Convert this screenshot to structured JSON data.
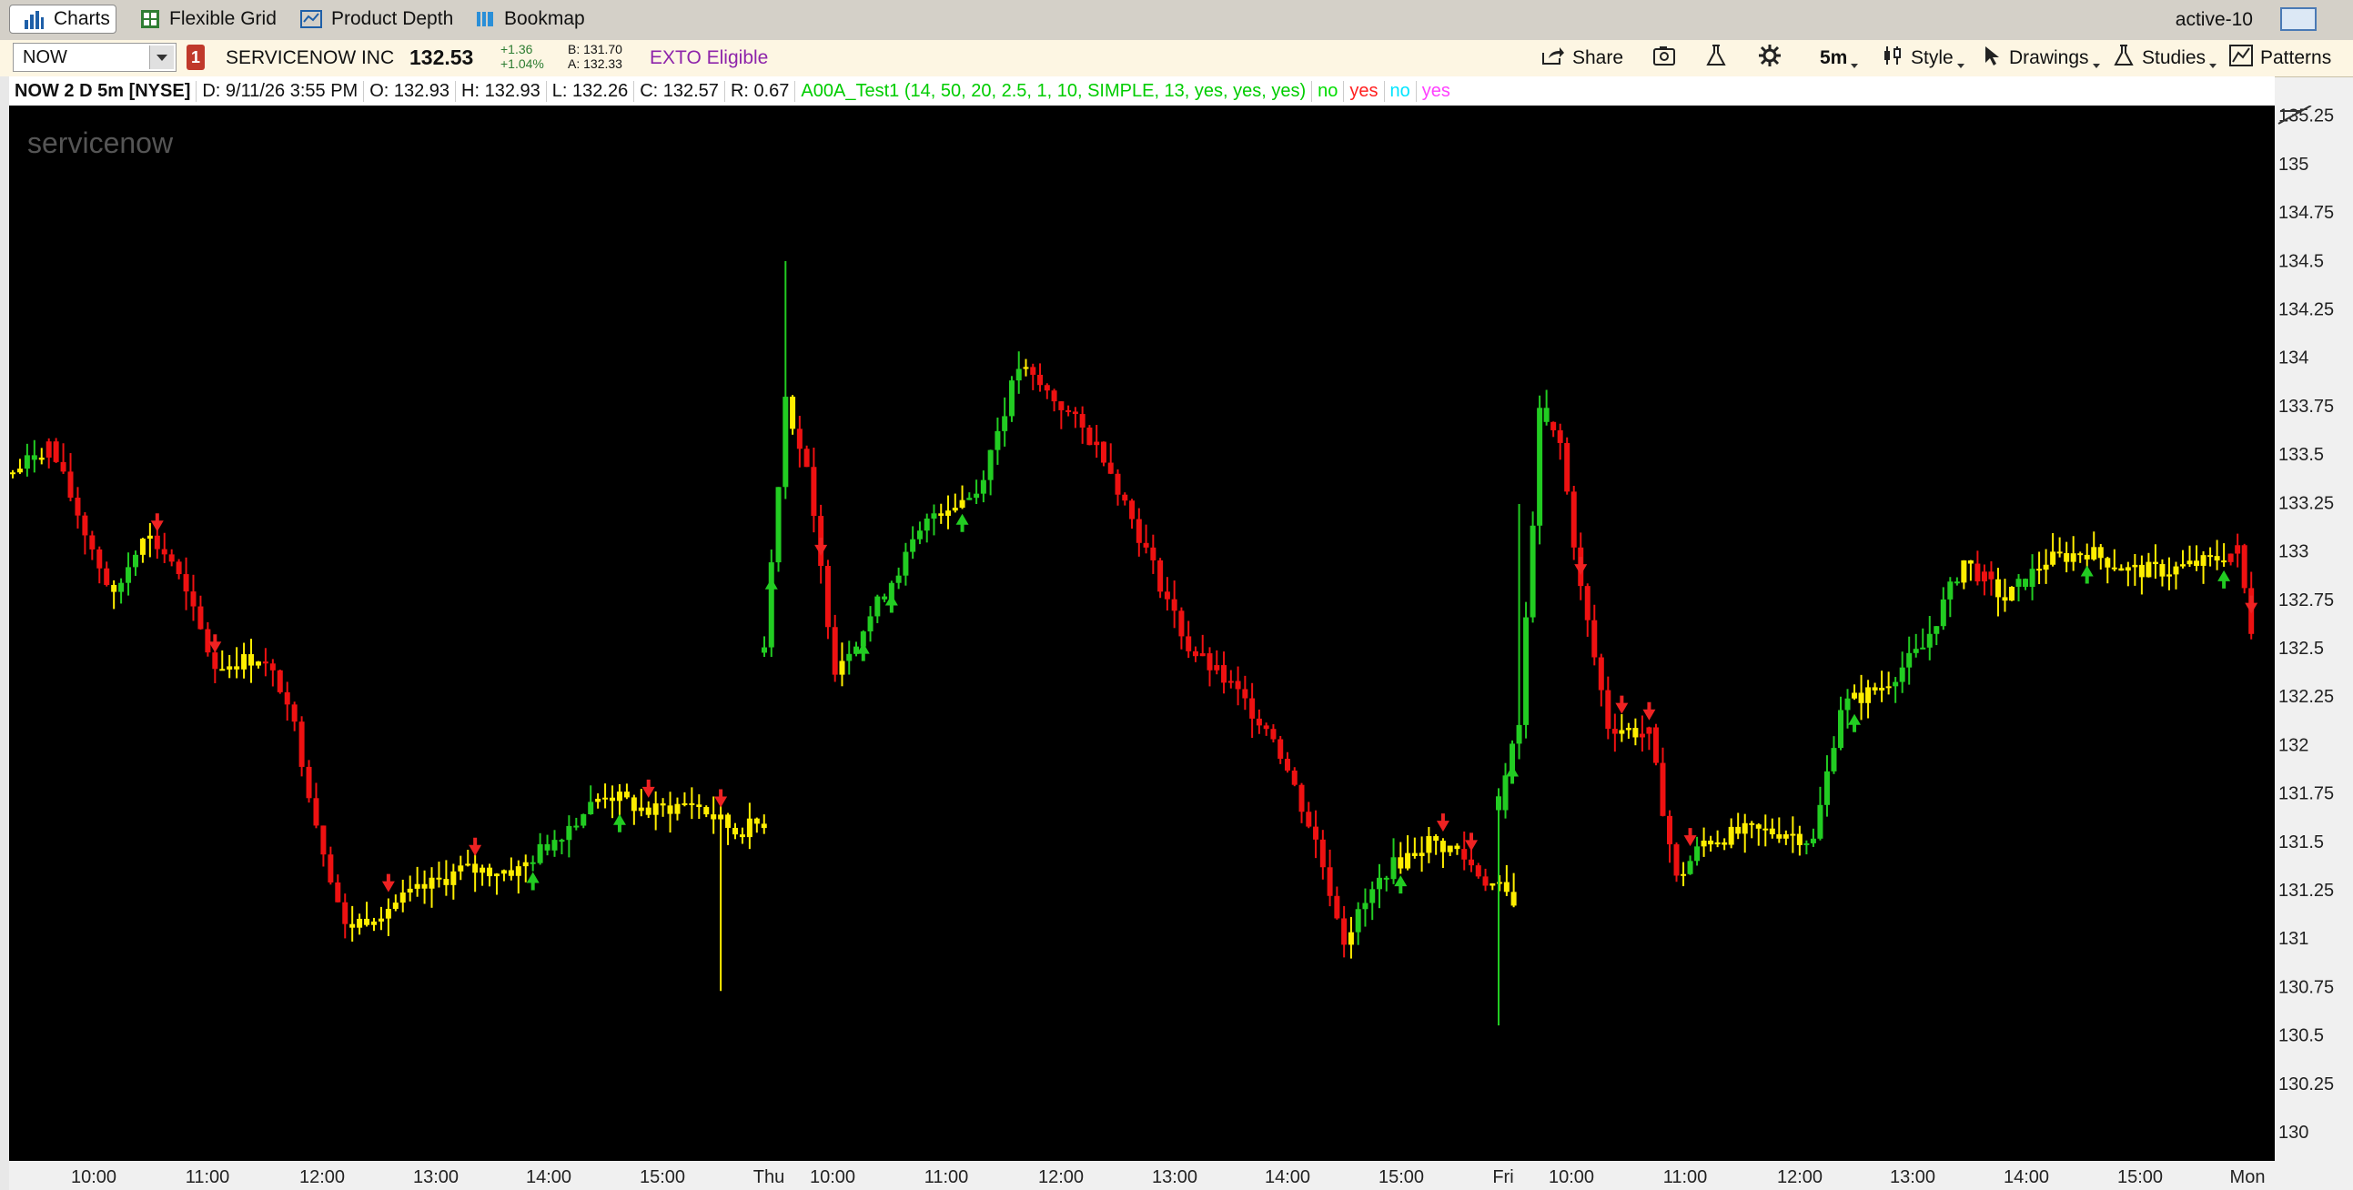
{
  "tabs": [
    {
      "label": "Charts",
      "icon": "bar-chart-icon",
      "active": true
    },
    {
      "label": "Flexible Grid",
      "icon": "grid-icon",
      "active": false
    },
    {
      "label": "Product Depth",
      "icon": "depth-icon",
      "active": false
    },
    {
      "label": "Bookmap",
      "icon": "bookmap-icon",
      "active": false
    }
  ],
  "active_link": "active-10",
  "symbol": "NOW",
  "alert_count": "1",
  "company": "SERVICENOW INC",
  "last": "132.53",
  "net_change": "+1.36",
  "pct_change": "+1.04%",
  "bid": "B: 131.70",
  "ask": "A: 132.33",
  "exto": "EXTO Eligible",
  "toolbar": {
    "share": "Share",
    "timeframe": "5m",
    "style": "Style",
    "drawings": "Drawings",
    "studies": "Studies",
    "patterns": "Patterns"
  },
  "info": {
    "title": "NOW 2 D 5m [NYSE]",
    "date": "D: 9/11/26 3:55 PM",
    "open": "O: 132.93",
    "high": "H: 132.93",
    "low": "L: 132.26",
    "close": "C: 132.57",
    "range": "R: 0.67",
    "study": "A00A_Test1 (14, 50, 20, 2.5, 1, 10, SIMPLE, 13, yes, yes, yes)",
    "flags": [
      {
        "text": "no",
        "color": "#00dd00"
      },
      {
        "text": "yes",
        "color": "#ff2020"
      },
      {
        "text": "no",
        "color": "#00e5ff"
      },
      {
        "text": "yes",
        "color": "#ff40ff"
      }
    ]
  },
  "watermark": "servicenow",
  "colors": {
    "background": "#000000",
    "bull": "#22cc22",
    "neutral": "#ffee00",
    "bear": "#ee1111",
    "buy_arrow": "#22cc22",
    "sell_arrow": "#ee2222",
    "study_text": "#00cc00"
  },
  "chart_data": {
    "type": "candlestick",
    "ylim": [
      129.85,
      135.3
    ],
    "yticks": [
      "135.25",
      "135",
      "134.75",
      "134.5",
      "134.25",
      "134",
      "133.75",
      "133.5",
      "133.25",
      "133",
      "132.75",
      "132.5",
      "132.25",
      "132",
      "131.75",
      "131.5",
      "131.25",
      "131",
      "130.75",
      "130.5",
      "130.25",
      "130"
    ],
    "xticks": [
      "10:00",
      "11:00",
      "12:00",
      "13:00",
      "14:00",
      "15:00",
      "Thu",
      "10:00",
      "11:00",
      "12:00",
      "13:00",
      "14:00",
      "15:00",
      "Fri",
      "10:00",
      "11:00",
      "12:00",
      "13:00",
      "14:00",
      "15:00",
      "Mon"
    ],
    "keypoints": [
      {
        "day": 0,
        "idx": 0,
        "price": 133.4
      },
      {
        "day": 0,
        "idx": 5,
        "price": 133.55
      },
      {
        "day": 0,
        "idx": 10,
        "price": 133.1
      },
      {
        "day": 0,
        "idx": 14,
        "price": 132.75
      },
      {
        "day": 0,
        "idx": 18,
        "price": 133.1
      },
      {
        "day": 0,
        "idx": 22,
        "price": 132.95
      },
      {
        "day": 0,
        "idx": 28,
        "price": 132.4
      },
      {
        "day": 0,
        "idx": 34,
        "price": 132.45
      },
      {
        "day": 0,
        "idx": 38,
        "price": 132.25
      },
      {
        "day": 0,
        "idx": 42,
        "price": 131.6
      },
      {
        "day": 0,
        "idx": 46,
        "price": 131.05
      },
      {
        "day": 0,
        "idx": 54,
        "price": 131.2
      },
      {
        "day": 0,
        "idx": 62,
        "price": 131.35
      },
      {
        "day": 0,
        "idx": 70,
        "price": 131.35
      },
      {
        "day": 0,
        "idx": 76,
        "price": 131.55
      },
      {
        "day": 0,
        "idx": 82,
        "price": 131.75
      },
      {
        "day": 0,
        "idx": 88,
        "price": 131.65
      },
      {
        "day": 0,
        "idx": 94,
        "price": 131.7
      },
      {
        "day": 0,
        "idx": 100,
        "price": 131.55
      },
      {
        "day": 0,
        "idx": 104,
        "price": 131.6
      },
      {
        "day": 1,
        "idx": 0,
        "price": 132.5
      },
      {
        "day": 1,
        "idx": 3,
        "price": 133.8
      },
      {
        "day": 1,
        "idx": 6,
        "price": 133.4
      },
      {
        "day": 1,
        "idx": 10,
        "price": 132.4
      },
      {
        "day": 1,
        "idx": 14,
        "price": 132.6
      },
      {
        "day": 1,
        "idx": 18,
        "price": 132.85
      },
      {
        "day": 1,
        "idx": 24,
        "price": 133.2
      },
      {
        "day": 1,
        "idx": 30,
        "price": 133.3
      },
      {
        "day": 1,
        "idx": 36,
        "price": 133.95
      },
      {
        "day": 1,
        "idx": 42,
        "price": 133.75
      },
      {
        "day": 1,
        "idx": 48,
        "price": 133.5
      },
      {
        "day": 1,
        "idx": 54,
        "price": 133.0
      },
      {
        "day": 1,
        "idx": 60,
        "price": 132.5
      },
      {
        "day": 1,
        "idx": 66,
        "price": 132.3
      },
      {
        "day": 1,
        "idx": 72,
        "price": 132.05
      },
      {
        "day": 1,
        "idx": 78,
        "price": 131.5
      },
      {
        "day": 1,
        "idx": 82,
        "price": 131.0
      },
      {
        "day": 1,
        "idx": 88,
        "price": 131.35
      },
      {
        "day": 1,
        "idx": 94,
        "price": 131.5
      },
      {
        "day": 1,
        "idx": 98,
        "price": 131.45
      },
      {
        "day": 1,
        "idx": 102,
        "price": 131.3
      },
      {
        "day": 1,
        "idx": 106,
        "price": 131.2
      },
      {
        "day": 2,
        "idx": 0,
        "price": 131.7
      },
      {
        "day": 2,
        "idx": 3,
        "price": 132.1
      },
      {
        "day": 2,
        "idx": 6,
        "price": 133.7
      },
      {
        "day": 2,
        "idx": 9,
        "price": 133.55
      },
      {
        "day": 2,
        "idx": 12,
        "price": 132.8
      },
      {
        "day": 2,
        "idx": 16,
        "price": 132.1
      },
      {
        "day": 2,
        "idx": 22,
        "price": 132.05
      },
      {
        "day": 2,
        "idx": 26,
        "price": 131.3
      },
      {
        "day": 2,
        "idx": 30,
        "price": 131.5
      },
      {
        "day": 2,
        "idx": 36,
        "price": 131.55
      },
      {
        "day": 2,
        "idx": 42,
        "price": 131.55
      },
      {
        "day": 2,
        "idx": 46,
        "price": 131.5
      },
      {
        "day": 2,
        "idx": 50,
        "price": 132.2
      },
      {
        "day": 2,
        "idx": 56,
        "price": 132.3
      },
      {
        "day": 2,
        "idx": 62,
        "price": 132.5
      },
      {
        "day": 2,
        "idx": 68,
        "price": 132.95
      },
      {
        "day": 2,
        "idx": 74,
        "price": 132.75
      },
      {
        "day": 2,
        "idx": 80,
        "price": 132.95
      },
      {
        "day": 2,
        "idx": 86,
        "price": 133.0
      },
      {
        "day": 2,
        "idx": 92,
        "price": 132.9
      },
      {
        "day": 2,
        "idx": 98,
        "price": 132.9
      },
      {
        "day": 2,
        "idx": 104,
        "price": 132.95
      },
      {
        "day": 2,
        "idx": 108,
        "price": 133.0
      },
      {
        "day": 2,
        "idx": 110,
        "price": 132.6
      }
    ],
    "signals": [
      {
        "day": 0,
        "idx": 20,
        "dir": "sell"
      },
      {
        "day": 0,
        "idx": 28,
        "dir": "sell"
      },
      {
        "day": 0,
        "idx": 52,
        "dir": "sell"
      },
      {
        "day": 0,
        "idx": 64,
        "dir": "sell"
      },
      {
        "day": 0,
        "idx": 72,
        "dir": "buy"
      },
      {
        "day": 0,
        "idx": 84,
        "dir": "buy"
      },
      {
        "day": 0,
        "idx": 88,
        "dir": "sell"
      },
      {
        "day": 0,
        "idx": 98,
        "dir": "sell"
      },
      {
        "day": 1,
        "idx": 1,
        "dir": "buy"
      },
      {
        "day": 1,
        "idx": 8,
        "dir": "sell"
      },
      {
        "day": 1,
        "idx": 14,
        "dir": "buy"
      },
      {
        "day": 1,
        "idx": 18,
        "dir": "buy"
      },
      {
        "day": 1,
        "idx": 28,
        "dir": "buy"
      },
      {
        "day": 1,
        "idx": 90,
        "dir": "buy"
      },
      {
        "day": 1,
        "idx": 96,
        "dir": "sell"
      },
      {
        "day": 1,
        "idx": 100,
        "dir": "sell"
      },
      {
        "day": 2,
        "idx": 2,
        "dir": "buy"
      },
      {
        "day": 2,
        "idx": 12,
        "dir": "sell"
      },
      {
        "day": 2,
        "idx": 18,
        "dir": "sell"
      },
      {
        "day": 2,
        "idx": 22,
        "dir": "sell"
      },
      {
        "day": 2,
        "idx": 28,
        "dir": "sell"
      },
      {
        "day": 2,
        "idx": 52,
        "dir": "buy"
      },
      {
        "day": 2,
        "idx": 86,
        "dir": "buy"
      },
      {
        "day": 2,
        "idx": 106,
        "dir": "buy"
      },
      {
        "day": 2,
        "idx": 110,
        "dir": "sell"
      }
    ],
    "grid": false,
    "legend": "none"
  }
}
